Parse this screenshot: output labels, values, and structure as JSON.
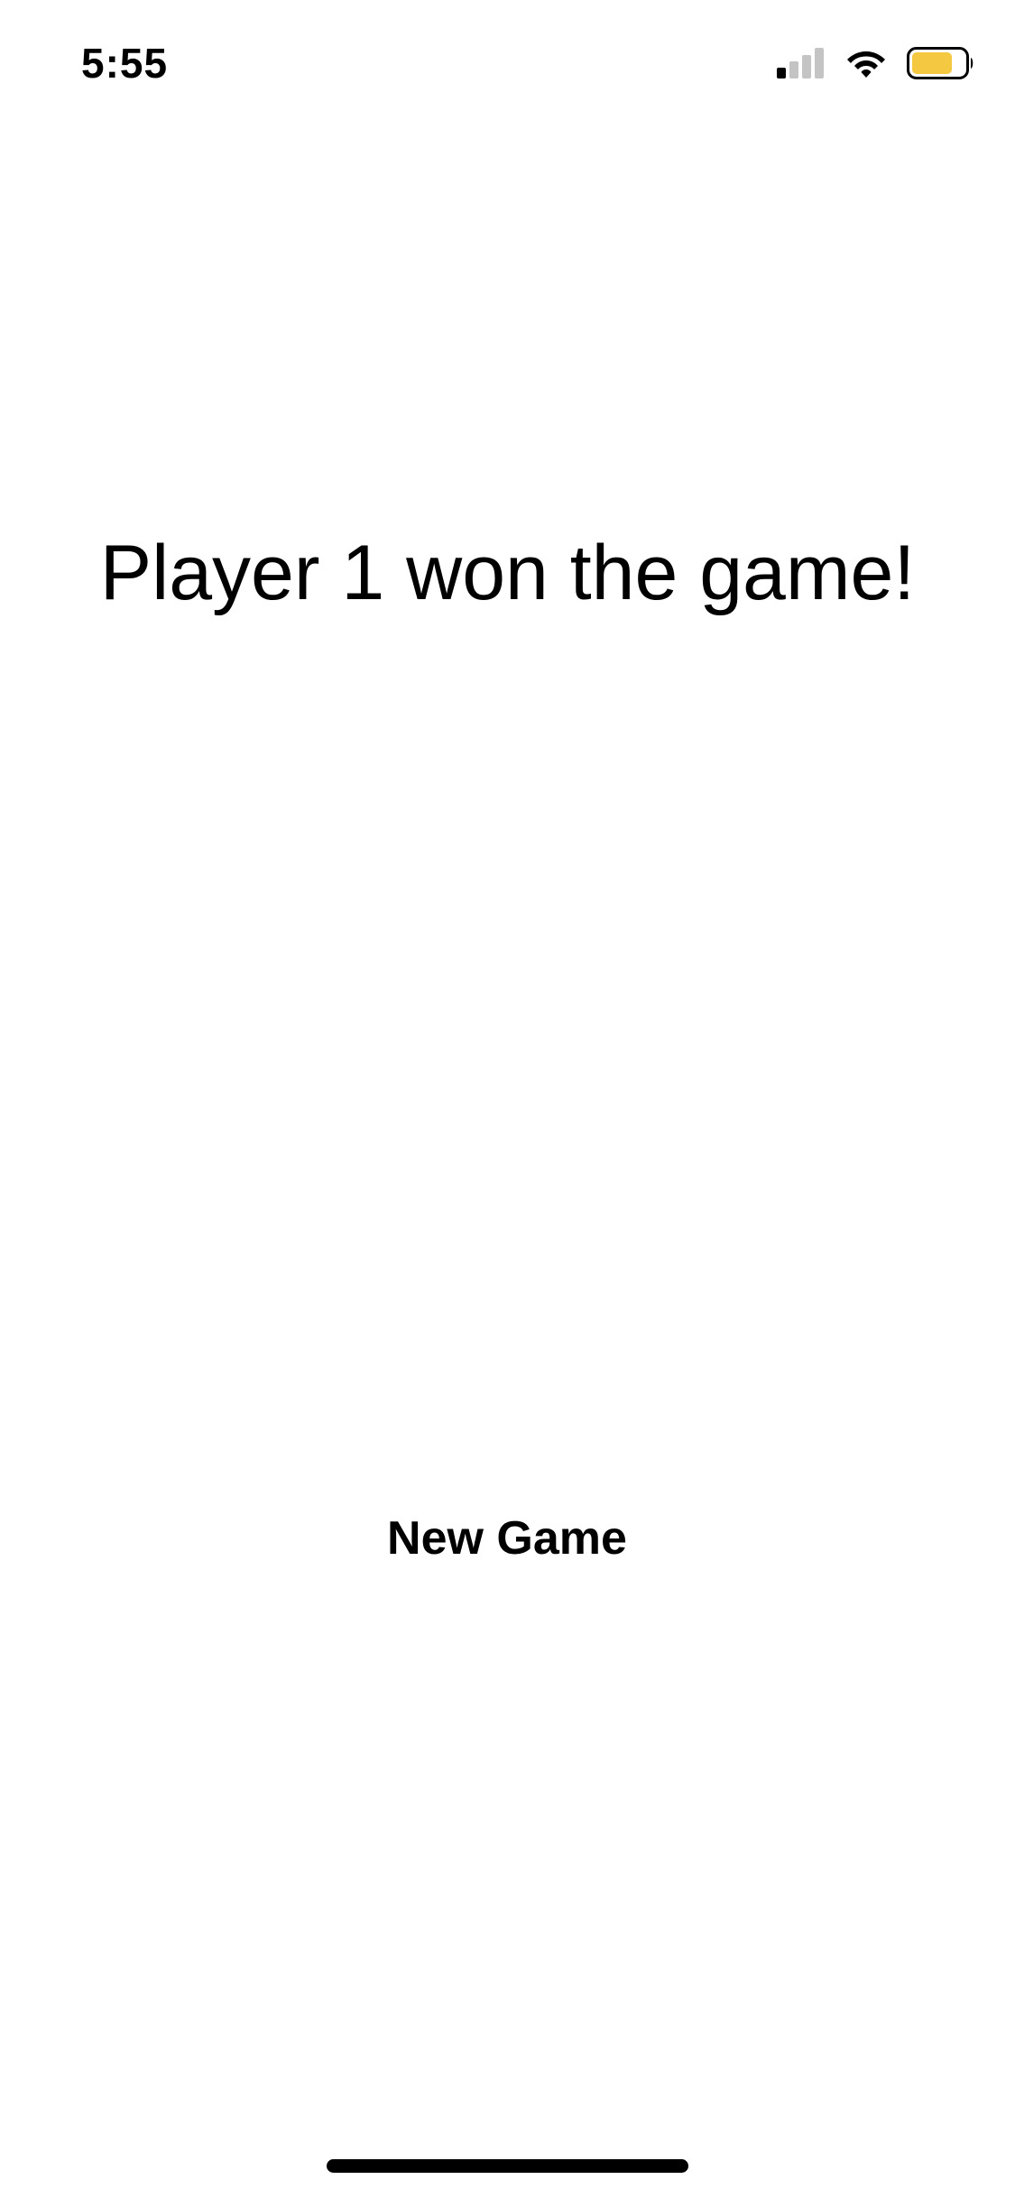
{
  "status_bar": {
    "time": "5:55",
    "icons": [
      "cellular-signal-icon",
      "wifi-icon",
      "battery-icon"
    ],
    "battery_color": "#f5c842",
    "signal_bars_active": 1,
    "signal_bars_total": 4
  },
  "main": {
    "message": "Player 1 won the game!",
    "new_game_label": "New Game"
  },
  "colors": {
    "background": "#ffffff",
    "text": "#000000"
  }
}
